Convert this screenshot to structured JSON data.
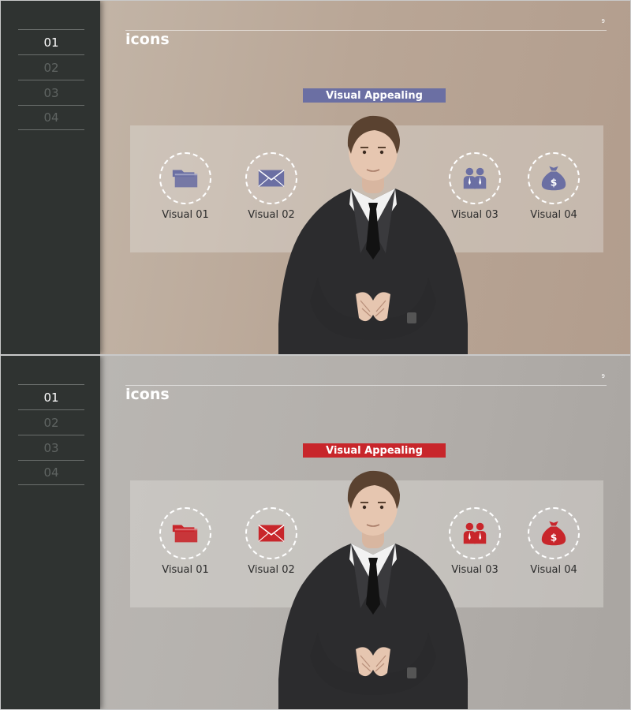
{
  "slides": [
    {
      "nav": [
        "01",
        "02",
        "03",
        "04"
      ],
      "active_nav": 0,
      "title": "icons",
      "page_number": "9",
      "banner": "Visual Appealing",
      "accent": "#6b6fa3",
      "icons": [
        {
          "name": "folder-icon",
          "label": "Visual 01"
        },
        {
          "name": "envelope-icon",
          "label": "Visual 02"
        },
        {
          "name": "people-icon",
          "label": "Visual 03"
        },
        {
          "name": "money-bag-icon",
          "label": "Visual 04"
        }
      ]
    },
    {
      "nav": [
        "01",
        "02",
        "03",
        "04"
      ],
      "active_nav": 0,
      "title": "icons",
      "page_number": "9",
      "banner": "Visual Appealing",
      "accent": "#c8262b",
      "icons": [
        {
          "name": "folder-icon",
          "label": "Visual 01"
        },
        {
          "name": "envelope-icon",
          "label": "Visual 02"
        },
        {
          "name": "people-icon",
          "label": "Visual 03"
        },
        {
          "name": "money-bag-icon",
          "label": "Visual 04"
        }
      ]
    }
  ]
}
